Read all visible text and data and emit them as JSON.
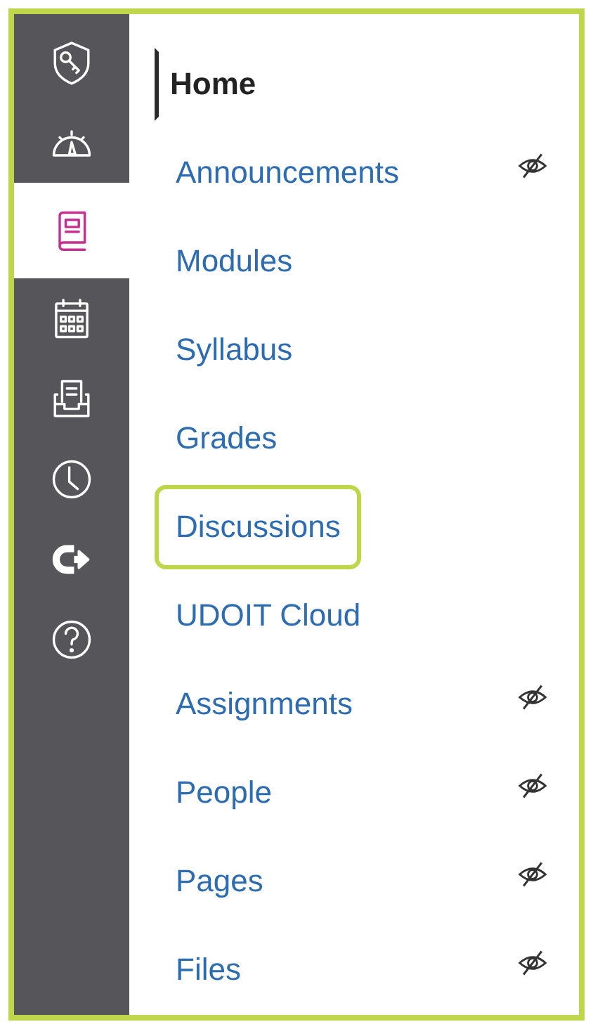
{
  "global_nav": [
    {
      "kind": "shield",
      "selected": false
    },
    {
      "kind": "gauge",
      "selected": false
    },
    {
      "kind": "book",
      "selected": true
    },
    {
      "kind": "calendar",
      "selected": false
    },
    {
      "kind": "inbox",
      "selected": false
    },
    {
      "kind": "clock",
      "selected": false
    },
    {
      "kind": "arrow",
      "selected": false
    },
    {
      "kind": "help",
      "selected": false
    }
  ],
  "course_nav": [
    {
      "label": "Home",
      "selected": true,
      "hidden": false,
      "highlighted": false
    },
    {
      "label": "Announcements",
      "selected": false,
      "hidden": true,
      "highlighted": false
    },
    {
      "label": "Modules",
      "selected": false,
      "hidden": false,
      "highlighted": false
    },
    {
      "label": "Syllabus",
      "selected": false,
      "hidden": false,
      "highlighted": false
    },
    {
      "label": "Grades",
      "selected": false,
      "hidden": false,
      "highlighted": false
    },
    {
      "label": "Discussions",
      "selected": false,
      "hidden": false,
      "highlighted": true
    },
    {
      "label": "UDOIT Cloud",
      "selected": false,
      "hidden": false,
      "highlighted": false
    },
    {
      "label": "Assignments",
      "selected": false,
      "hidden": true,
      "highlighted": false
    },
    {
      "label": "People",
      "selected": false,
      "hidden": true,
      "highlighted": false
    },
    {
      "label": "Pages",
      "selected": false,
      "hidden": true,
      "highlighted": false
    },
    {
      "label": "Files",
      "selected": false,
      "hidden": true,
      "highlighted": false
    }
  ]
}
